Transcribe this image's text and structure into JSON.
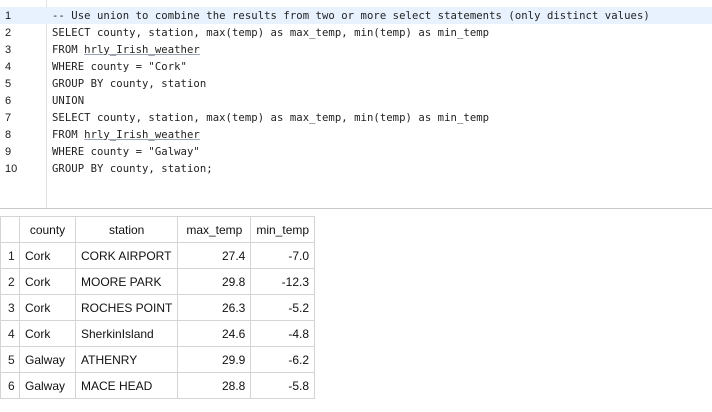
{
  "editor": {
    "lines": [
      {
        "num": "1",
        "comment": "-- Use union to combine the results from two or more select statements (only distinct values)"
      },
      {
        "num": "2",
        "text": "SELECT county, station, max(temp) as max_temp, min(temp) as min_temp"
      },
      {
        "num": "3",
        "prefix": "FROM ",
        "table": "hrly_Irish_weather"
      },
      {
        "num": "4",
        "text": "WHERE county = \"Cork\""
      },
      {
        "num": "5",
        "text": "GROUP BY county, station"
      },
      {
        "num": "6",
        "text": "UNION"
      },
      {
        "num": "7",
        "text": "SELECT county, station, max(temp) as max_temp, min(temp) as min_temp"
      },
      {
        "num": "8",
        "prefix": "FROM ",
        "table": "hrly_Irish_weather"
      },
      {
        "num": "9",
        "text": "WHERE county = \"Galway\""
      },
      {
        "num": "10",
        "text": "GROUP BY county, station;"
      }
    ]
  },
  "results": {
    "columns": [
      "county",
      "station",
      "max_temp",
      "min_temp"
    ],
    "rows": [
      {
        "n": "1",
        "county": "Cork",
        "station": "CORK AIRPORT",
        "max_temp": "27.4",
        "min_temp": "-7.0"
      },
      {
        "n": "2",
        "county": "Cork",
        "station": "MOORE PARK",
        "max_temp": "29.8",
        "min_temp": "-12.3"
      },
      {
        "n": "3",
        "county": "Cork",
        "station": "ROCHES POINT",
        "max_temp": "26.3",
        "min_temp": "-5.2"
      },
      {
        "n": "4",
        "county": "Cork",
        "station": "SherkinIsland",
        "max_temp": "24.6",
        "min_temp": "-4.8"
      },
      {
        "n": "5",
        "county": "Galway",
        "station": "ATHENRY",
        "max_temp": "29.9",
        "min_temp": "-6.2"
      },
      {
        "n": "6",
        "county": "Galway",
        "station": "MACE HEAD",
        "max_temp": "28.8",
        "min_temp": "-5.8"
      }
    ]
  }
}
